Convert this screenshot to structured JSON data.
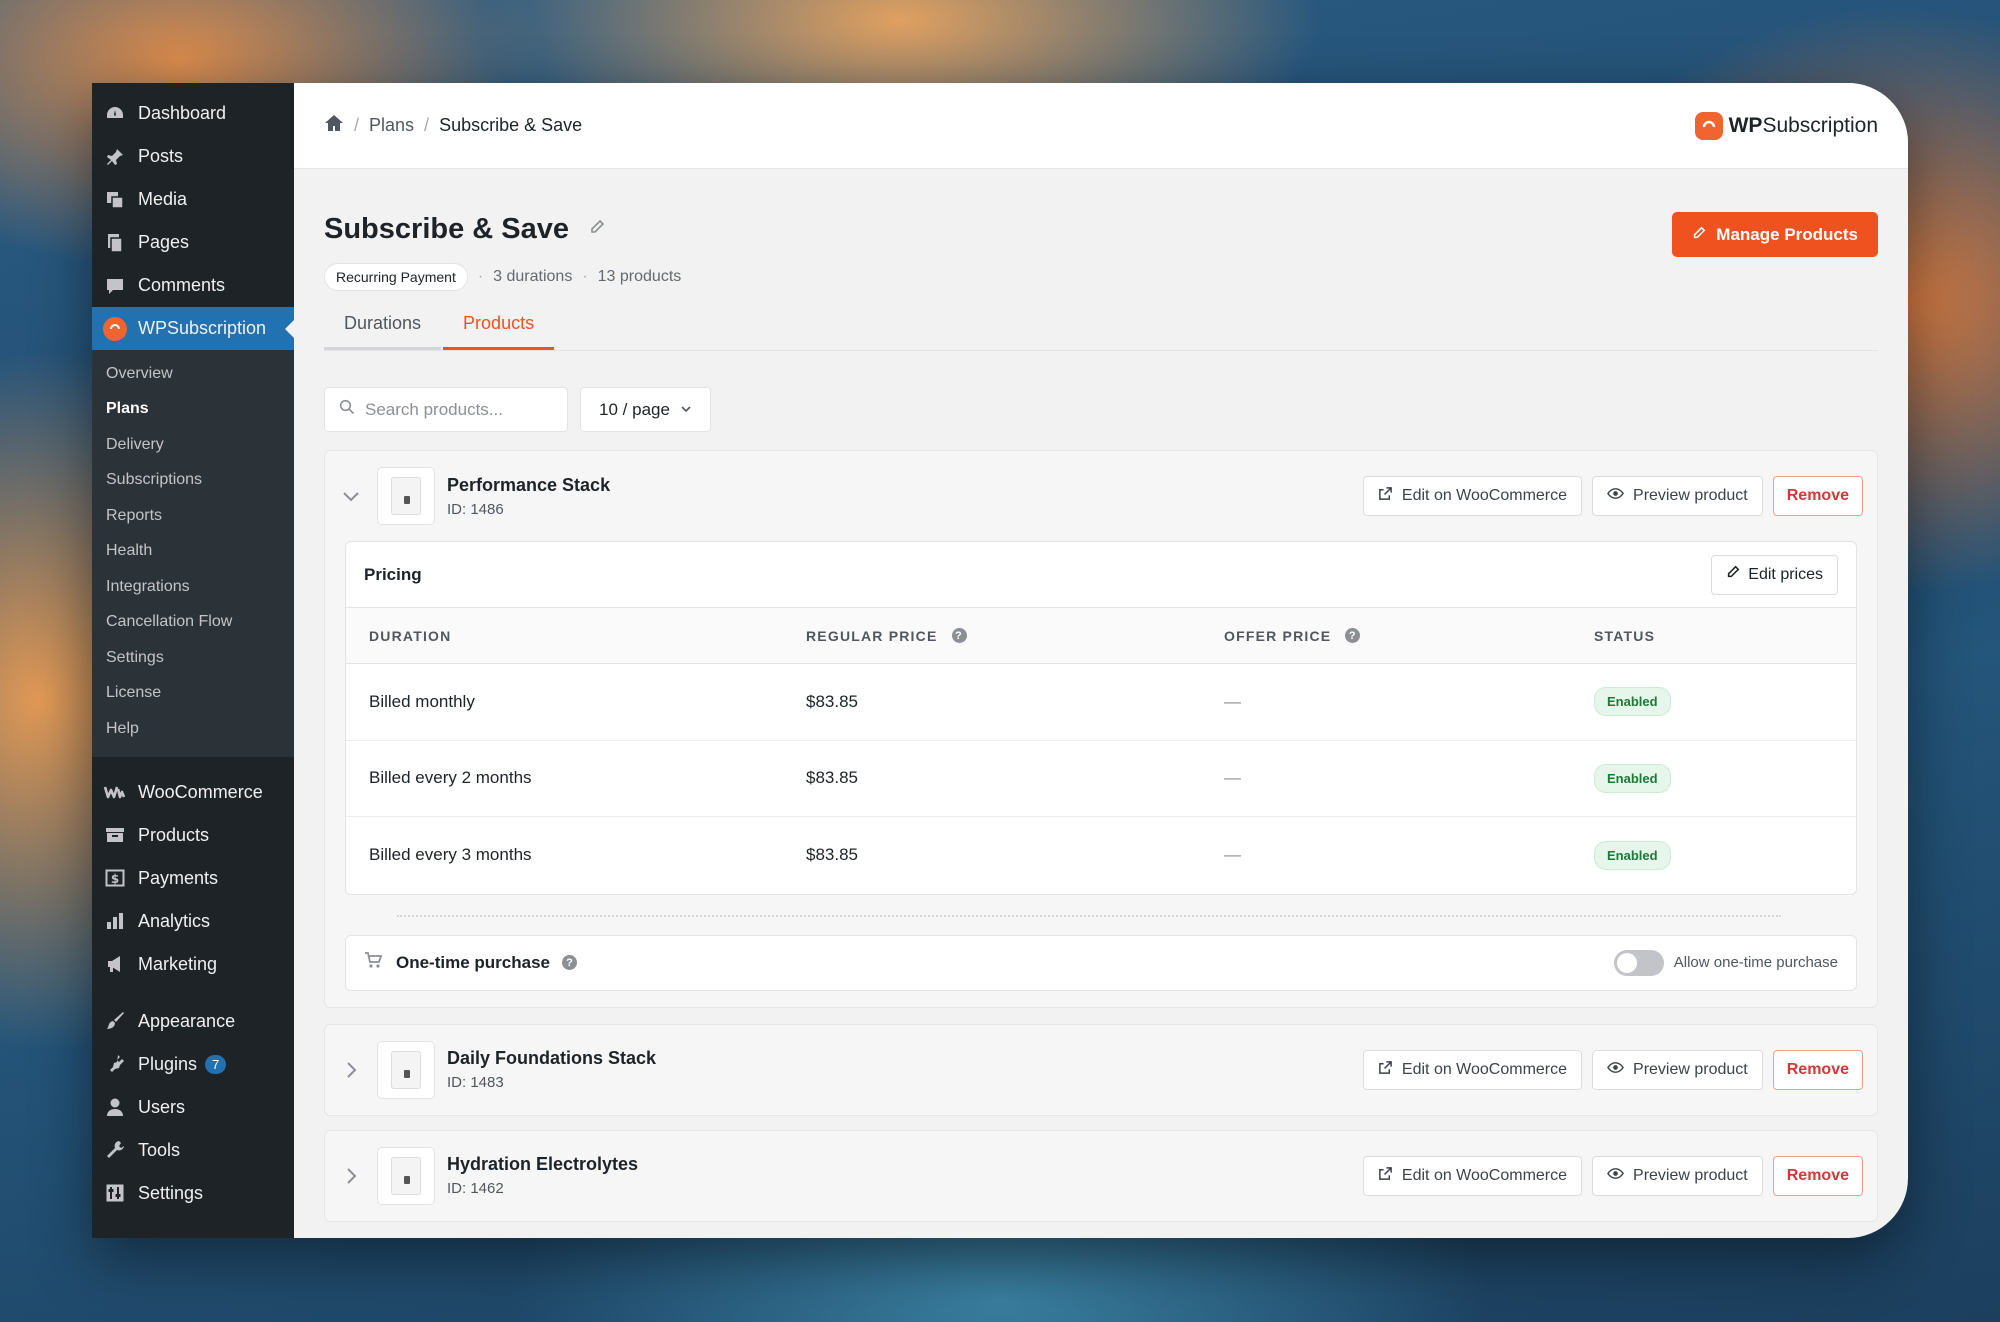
{
  "sidebar": {
    "top": [
      {
        "label": "Dashboard",
        "icon": "dashboard-icon"
      },
      {
        "label": "Posts",
        "icon": "pin-icon"
      },
      {
        "label": "Media",
        "icon": "media-icon"
      },
      {
        "label": "Pages",
        "icon": "pages-icon"
      },
      {
        "label": "Comments",
        "icon": "comment-icon"
      },
      {
        "label": "WPSubscription",
        "icon": "wpsubscription-icon"
      }
    ],
    "submenu": [
      "Overview",
      "Plans",
      "Delivery",
      "Subscriptions",
      "Reports",
      "Health",
      "Integrations",
      "Cancellation Flow",
      "Settings",
      "License",
      "Help"
    ],
    "woo": [
      {
        "label": "WooCommerce",
        "icon": "woocommerce-icon"
      },
      {
        "label": "Products",
        "icon": "archive-icon"
      },
      {
        "label": "Payments",
        "icon": "payments-icon"
      },
      {
        "label": "Analytics",
        "icon": "analytics-icon"
      },
      {
        "label": "Marketing",
        "icon": "megaphone-icon"
      }
    ],
    "bottom": [
      {
        "label": "Appearance",
        "icon": "brush-icon"
      },
      {
        "label": "Plugins",
        "icon": "plugin-icon",
        "badge": "7"
      },
      {
        "label": "Users",
        "icon": "user-icon"
      },
      {
        "label": "Tools",
        "icon": "wrench-icon"
      },
      {
        "label": "Settings",
        "icon": "settings-icon"
      }
    ]
  },
  "breadcrumb": {
    "plans": "Plans",
    "current": "Subscribe & Save"
  },
  "brand": {
    "bold": "WP",
    "rest": "Subscription"
  },
  "page": {
    "title": "Subscribe & Save",
    "manage_label": "Manage Products",
    "pill": "Recurring Payment",
    "durations": "3 durations",
    "products": "13 products"
  },
  "tabs": [
    "Durations",
    "Products"
  ],
  "filters": {
    "search_placeholder": "Search products...",
    "per_page": "10 / page"
  },
  "actions": {
    "edit_woo": "Edit on WooCommerce",
    "preview": "Preview product",
    "remove": "Remove"
  },
  "products": [
    {
      "name": "Performance Stack",
      "id": "ID: 1486"
    },
    {
      "name": "Daily Foundations Stack",
      "id": "ID: 1483"
    },
    {
      "name": "Hydration Electrolytes",
      "id": "ID: 1462"
    }
  ],
  "pricing": {
    "title": "Pricing",
    "edit_label": "Edit prices",
    "headers": [
      "DURATION",
      "REGULAR PRICE",
      "OFFER PRICE",
      "STATUS"
    ],
    "rows": [
      {
        "duration": "Billed monthly",
        "regular": "$83.85",
        "offer": "—",
        "status": "Enabled"
      },
      {
        "duration": "Billed every 2 months",
        "regular": "$83.85",
        "offer": "—",
        "status": "Enabled"
      },
      {
        "duration": "Billed every 3 months",
        "regular": "$83.85",
        "offer": "—",
        "status": "Enabled"
      }
    ]
  },
  "onetime": {
    "label": "One-time purchase",
    "toggle_label": "Allow one-time purchase"
  },
  "colors": {
    "accent": "#f0521f",
    "wp_blue": "#2271b1",
    "sidebar": "#1d2327"
  }
}
